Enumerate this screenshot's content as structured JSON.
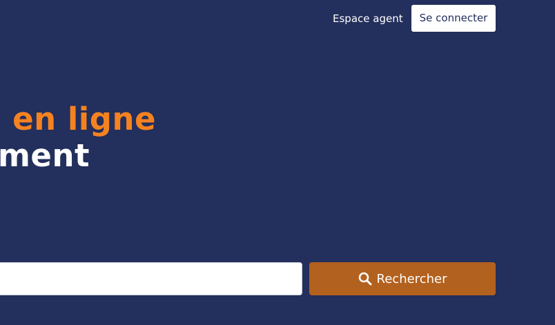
{
  "header": {
    "agent_link": "Espace agent",
    "login_button": "Se connecter"
  },
  "hero": {
    "line_1": "us en ligne",
    "line_2": "ement"
  },
  "search": {
    "input_value": "",
    "button_label": "Rechercher",
    "button_icon": "search-icon"
  },
  "colors": {
    "background": "#232f5c",
    "accent_orange": "#f58220",
    "search_button": "#b3611e"
  }
}
